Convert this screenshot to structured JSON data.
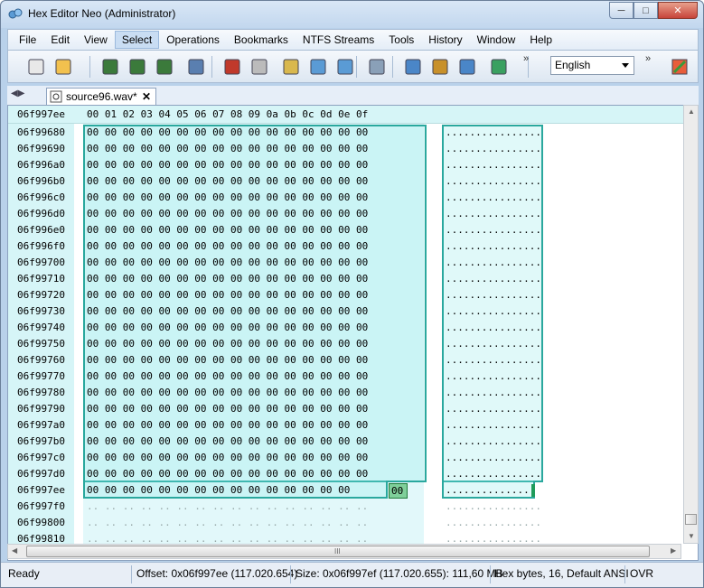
{
  "window": {
    "title": "Hex Editor Neo (Administrator)"
  },
  "menu": [
    "File",
    "Edit",
    "View",
    "Select",
    "Operations",
    "Bookmarks",
    "NTFS Streams",
    "Tools",
    "History",
    "Window",
    "Help"
  ],
  "menu_active": "Select",
  "toolbar": {
    "language": "English",
    "icons": [
      "new-file-icon",
      "open-folder-icon",
      "save-icon",
      "save-as-icon",
      "save-all-icon",
      "print-icon",
      "undo-icon",
      "redo-icon",
      "properties-icon",
      "copy-icon",
      "paste-icon",
      "export-icon",
      "find-icon",
      "find-next-icon",
      "find-previous-icon",
      "bookmark-icon",
      "customize-icon"
    ]
  },
  "tab": {
    "name": "source96.wav*"
  },
  "editor": {
    "header_offset": "06f997ee",
    "columns": [
      "00",
      "01",
      "02",
      "03",
      "04",
      "05",
      "06",
      "07",
      "08",
      "09",
      "0a",
      "0b",
      "0c",
      "0d",
      "0e",
      "0f"
    ],
    "rows": [
      {
        "addr": "06f99680",
        "hex": "00 00  00 00  00 00  00 00  00 00  00 00  00 00  00 00",
        "ascii": "................"
      },
      {
        "addr": "06f99690",
        "hex": "00 00  00 00  00 00  00 00  00 00  00 00  00 00  00 00",
        "ascii": "................"
      },
      {
        "addr": "06f996a0",
        "hex": "00 00  00 00  00 00  00 00  00 00  00 00  00 00  00 00",
        "ascii": "................"
      },
      {
        "addr": "06f996b0",
        "hex": "00 00  00 00  00 00  00 00  00 00  00 00  00 00  00 00",
        "ascii": "................"
      },
      {
        "addr": "06f996c0",
        "hex": "00 00  00 00  00 00  00 00  00 00  00 00  00 00  00 00",
        "ascii": "................"
      },
      {
        "addr": "06f996d0",
        "hex": "00 00  00 00  00 00  00 00  00 00  00 00  00 00  00 00",
        "ascii": "................"
      },
      {
        "addr": "06f996e0",
        "hex": "00 00  00 00  00 00  00 00  00 00  00 00  00 00  00 00",
        "ascii": "................"
      },
      {
        "addr": "06f996f0",
        "hex": "00 00  00 00  00 00  00 00  00 00  00 00  00 00  00 00",
        "ascii": "................"
      },
      {
        "addr": "06f99700",
        "hex": "00 00  00 00  00 00  00 00  00 00  00 00  00 00  00 00",
        "ascii": "................"
      },
      {
        "addr": "06f99710",
        "hex": "00 00  00 00  00 00  00 00  00 00  00 00  00 00  00 00",
        "ascii": "................"
      },
      {
        "addr": "06f99720",
        "hex": "00 00  00 00  00 00  00 00  00 00  00 00  00 00  00 00",
        "ascii": "................"
      },
      {
        "addr": "06f99730",
        "hex": "00 00  00 00  00 00  00 00  00 00  00 00  00 00  00 00",
        "ascii": "................"
      },
      {
        "addr": "06f99740",
        "hex": "00 00  00 00  00 00  00 00  00 00  00 00  00 00  00 00",
        "ascii": "................"
      },
      {
        "addr": "06f99750",
        "hex": "00 00  00 00  00 00  00 00  00 00  00 00  00 00  00 00",
        "ascii": "................"
      },
      {
        "addr": "06f99760",
        "hex": "00 00  00 00  00 00  00 00  00 00  00 00  00 00  00 00",
        "ascii": "................"
      },
      {
        "addr": "06f99770",
        "hex": "00 00  00 00  00 00  00 00  00 00  00 00  00 00  00 00",
        "ascii": "................"
      },
      {
        "addr": "06f99780",
        "hex": "00 00  00 00  00 00  00 00  00 00  00 00  00 00  00 00",
        "ascii": "................"
      },
      {
        "addr": "06f99790",
        "hex": "00 00  00 00  00 00  00 00  00 00  00 00  00 00  00 00",
        "ascii": "................"
      },
      {
        "addr": "06f997a0",
        "hex": "00 00  00 00  00 00  00 00  00 00  00 00  00 00  00 00",
        "ascii": "................"
      },
      {
        "addr": "06f997b0",
        "hex": "00 00  00 00  00 00  00 00  00 00  00 00  00 00  00 00",
        "ascii": "................"
      },
      {
        "addr": "06f997c0",
        "hex": "00 00  00 00  00 00  00 00  00 00  00 00  00 00  00 00",
        "ascii": "................"
      },
      {
        "addr": "06f997d0",
        "hex": "00 00  00 00  00 00  00 00  00 00  00 00  00 00  00 00",
        "ascii": "................"
      },
      {
        "addr": "06f997ee",
        "hex": "00 00  00 00  00 00  00 00  00 00  00 00  00 00  00",
        "ascii": "..............."
      },
      {
        "addr": "06f997f0",
        "hex": "..  ..  ..  ..  ..  ..  ..  ..  ..  ..  ..  ..  ..  ..  ..  ..",
        "ascii": "................"
      },
      {
        "addr": "06f99800",
        "hex": "..  ..  ..  ..  ..  ..  ..  ..  ..  ..  ..  ..  ..  ..  ..  ..",
        "ascii": "................"
      },
      {
        "addr": "06f99810",
        "hex": "..  ..  ..  ..  ..  ..  ..  ..  ..  ..  ..  ..  ..  ..  ..  ..",
        "ascii": "................"
      }
    ],
    "current_byte": "00"
  },
  "status": {
    "ready": "Ready",
    "offset": "Offset: 0x06f997ee (117.020.654)",
    "size": "Size: 0x06f997ef (117.020.655): 111,60 MB",
    "mode": "Hex bytes, 16, Default ANSI",
    "ovr": "OVR"
  },
  "scroll_grip": "III"
}
